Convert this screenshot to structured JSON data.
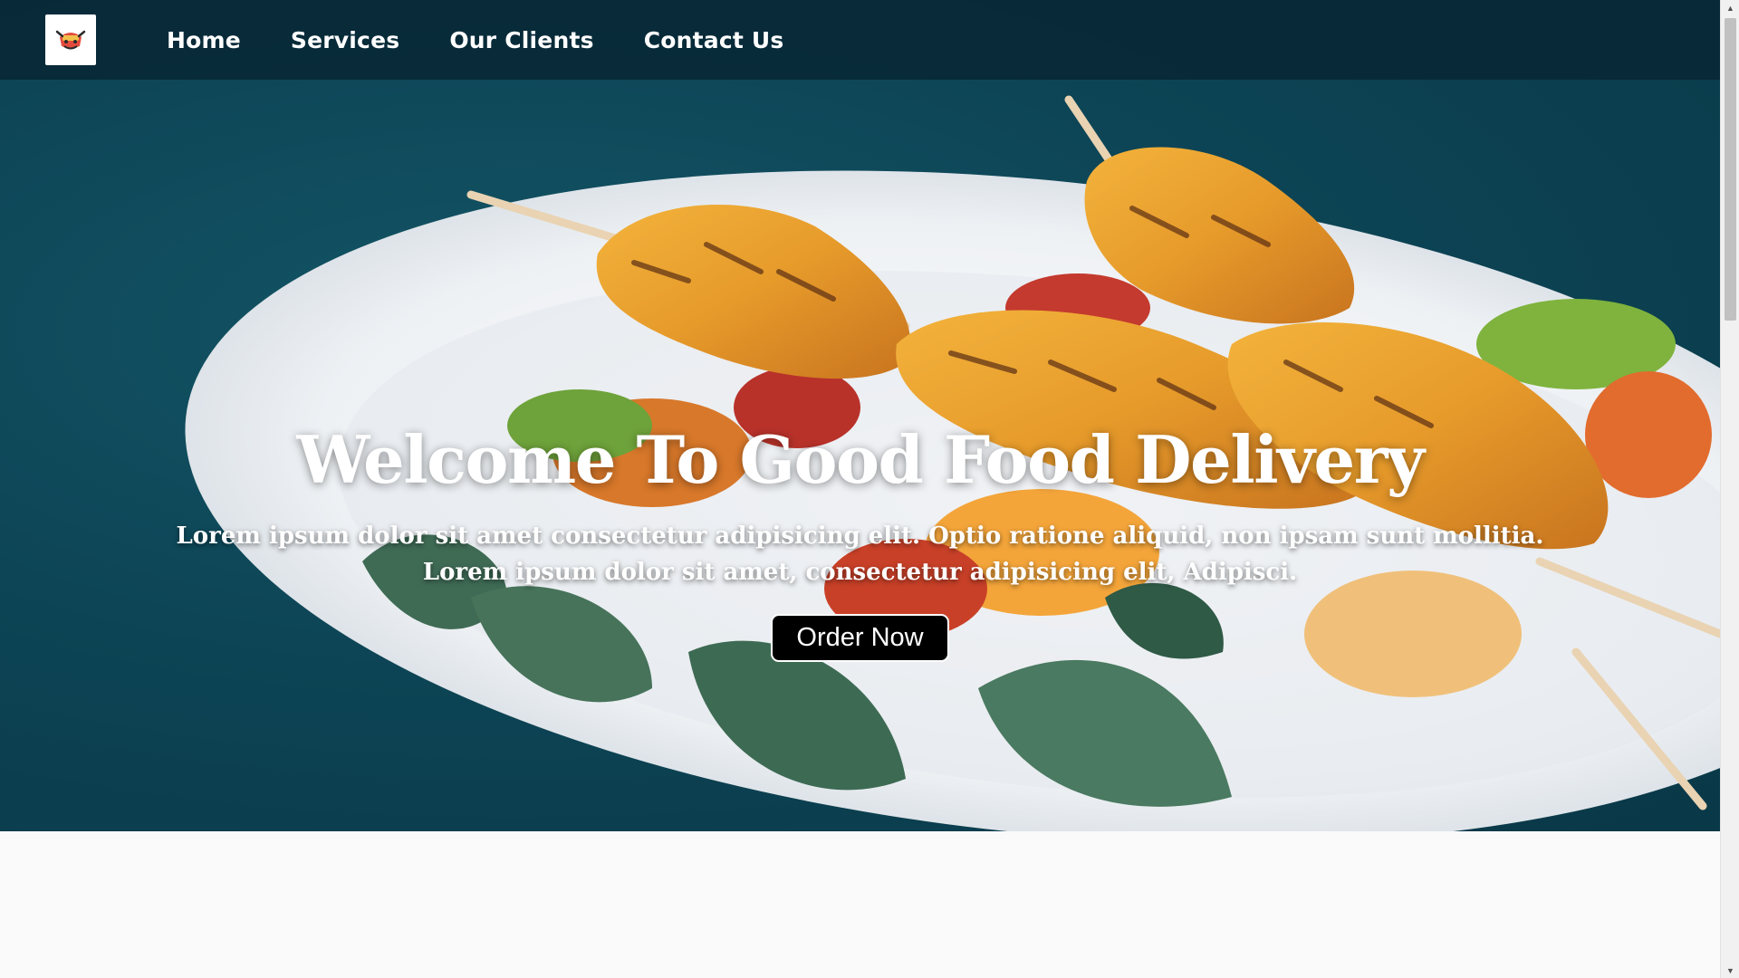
{
  "nav": {
    "logo_alt": "Good Food Delivery logo",
    "links": [
      "Home",
      "Services",
      "Our Clients",
      "Contact Us"
    ]
  },
  "hero": {
    "title": "Welcome To Good Food Delivery",
    "subtitle_line1": "Lorem ipsum dolor sit amet consectetur adipisicing elit. Optio ratione aliquid, non ipsam sunt mollitia.",
    "subtitle_line2": "Lorem ipsum dolor sit amet, consectetur adipisicing elit, Adipisci.",
    "cta_label": "Order Now",
    "background_image": "grilled chicken skewers with vegetables on white plate"
  },
  "icons": {
    "logo": "chef-logo-icon",
    "scroll_up": "scroll-up-arrow-icon",
    "scroll_down": "scroll-down-arrow-icon"
  },
  "colors": {
    "navbar_bg": "#082634",
    "hero_bg": "#0d4556",
    "button_bg": "#000000",
    "text": "#ffffff",
    "page_bg": "#fafafa"
  }
}
